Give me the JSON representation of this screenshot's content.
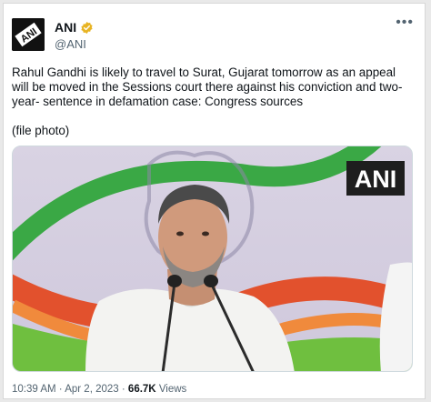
{
  "tweet": {
    "author_name": "ANI",
    "author_handle": "@ANI",
    "avatar_logo_text": "ANI",
    "text": "Rahul Gandhi is likely to travel to Surat, Gujarat tomorrow as an appeal will be moved in the Sessions court there against his conviction and two-year- sentence in defamation case: Congress sources",
    "subtext": "(file photo)",
    "media": {
      "watermark": "ANI"
    },
    "time": "10:39 AM",
    "date": "Apr 2, 2023",
    "separator": "·",
    "views_count": "66.7K",
    "views_label": "Views"
  },
  "colors": {
    "verified_badge": "#e8b423",
    "secondary_text": "#536471",
    "primary_text": "#0f1419"
  },
  "icons": {
    "verified": "verified-badge-icon",
    "more": "more-options-icon"
  }
}
